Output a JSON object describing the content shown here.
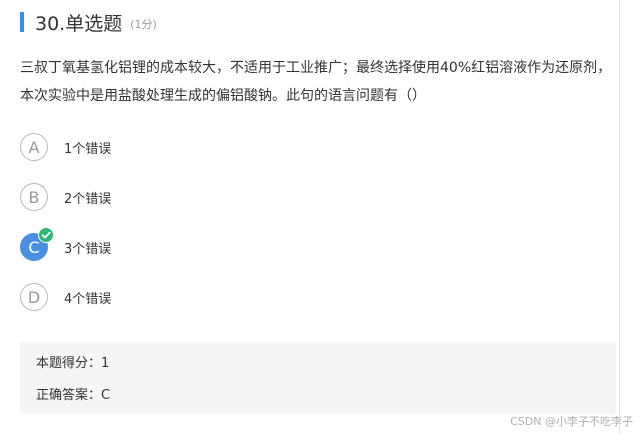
{
  "question": {
    "number_title": "30.单选题",
    "score": "(1分)",
    "text": "三叔丁氧基氢化铝锂的成本较大，不适用于工业推广；最终选择使用40%红铝溶液作为还原剂，本次实验中是用盐酸处理生成的偏铝酸钠。此句的语言问题有（）"
  },
  "options": [
    {
      "letter": "A",
      "label": "1个错误",
      "selected": false
    },
    {
      "letter": "B",
      "label": "2个错误",
      "selected": false
    },
    {
      "letter": "C",
      "label": "3个错误",
      "selected": true
    },
    {
      "letter": "D",
      "label": "4个错误",
      "selected": false
    }
  ],
  "result": {
    "score_line": "本题得分：1",
    "answer_line": "正确答案：C"
  },
  "watermark": "CSDN @小李子不吃李子",
  "colors": {
    "accent_bar": "#3a8ee6",
    "selected_option": "#4a90e2",
    "check_badge": "#2fb576",
    "result_bg": "#f5f5f5"
  },
  "icons": {
    "check_badge": "check-icon"
  }
}
